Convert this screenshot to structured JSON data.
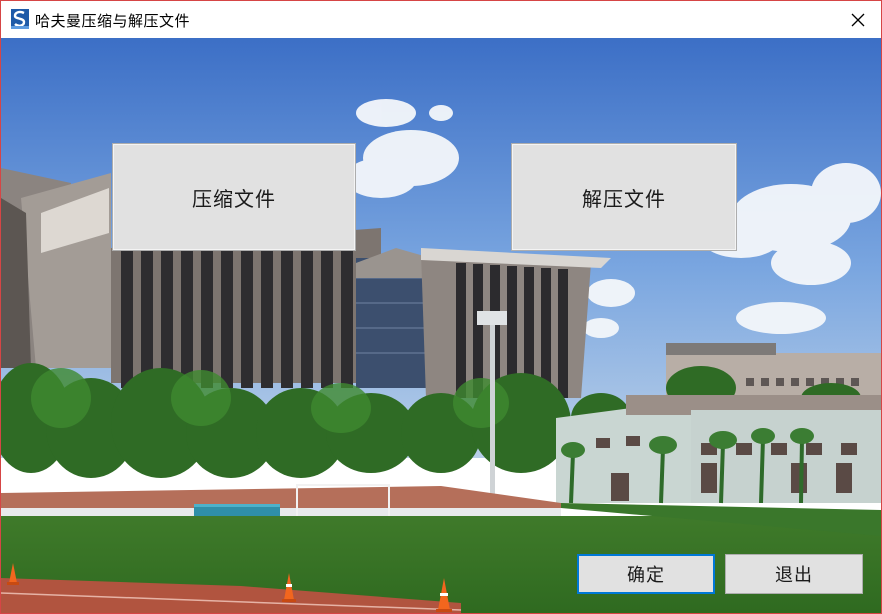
{
  "window": {
    "title": "哈夫曼压缩与解压文件",
    "app_icon": "app-logo-icon",
    "close_icon": "close-icon"
  },
  "buttons": {
    "compress_label": "压缩文件",
    "decompress_label": "解压文件",
    "ok_label": "确定",
    "exit_label": "退出"
  },
  "colors": {
    "window_border": "#d64545",
    "button_face": "#e1e1e1",
    "button_border": "#adadad",
    "default_button_border": "#0078d7"
  }
}
